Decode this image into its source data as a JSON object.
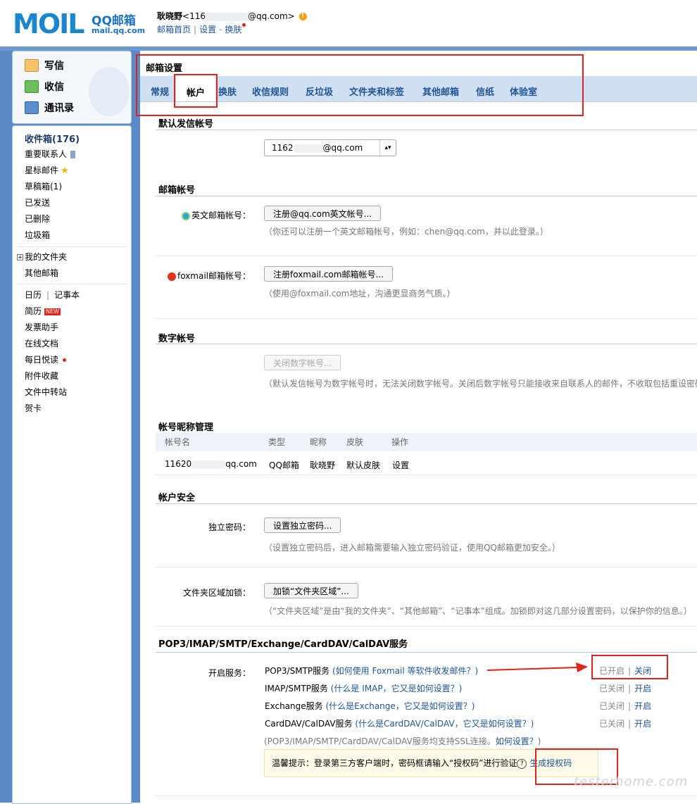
{
  "logo": {
    "big": "MOIL",
    "cn": "QQ邮箱",
    "domain": "mail.qq.com"
  },
  "user": {
    "name": "耿晓野",
    "email_prefix": "<116",
    "email_suffix": "@qq.com>",
    "links": {
      "home": "邮箱首页",
      "settings": "设置",
      "sep": "-",
      "skin": "换肤"
    }
  },
  "actions": [
    {
      "label": "写信",
      "icon": "pencil-icon"
    },
    {
      "label": "收信",
      "icon": "inbox-icon"
    },
    {
      "label": "通讯录",
      "icon": "contacts-icon"
    }
  ],
  "folders": {
    "inbox": "收件箱(176)",
    "vip": "重要联系人",
    "starred": "星标邮件",
    "drafts": "草稿箱(1)",
    "sent": "已发送",
    "deleted": "已删除",
    "spam": "垃圾箱",
    "my_folders": "我的文件夹",
    "other_mail": "其他邮箱",
    "calendar": "日历",
    "cal_sep": "|",
    "notes": "记事本",
    "resume": "简历",
    "new_badge": "NEW",
    "invoice": "发票助手",
    "docs": "在线文档",
    "daily": "每日悦读",
    "attach": "附件收藏",
    "transfer": "文件中转站",
    "card": "贺卡"
  },
  "settings": {
    "title": "邮箱设置",
    "tabs": [
      "常规",
      "帐户",
      "换肤",
      "收信规则",
      "反垃圾",
      "文件夹和标签",
      "其他邮箱",
      "信纸",
      "体验室"
    ],
    "active_tab": "帐户"
  },
  "default_sender": {
    "title": "默认发信帐号",
    "prefix": "1162",
    "suffix": "@qq.com"
  },
  "mail_accounts": {
    "title": "邮箱帐号",
    "english_label": "英文邮箱帐号：",
    "english_button": "注册@qq.com英文帐号...",
    "english_hint": "（你还可以注册一个英文邮箱帐号，例如：chen@qq.com，并以此登录。）",
    "foxmail_label": "foxmail邮箱帐号：",
    "foxmail_button": "注册foxmail.com邮箱帐号...",
    "foxmail_hint": "（使用@foxmail.com地址，沟通更显商务气质。）"
  },
  "digital": {
    "title": "数字帐号",
    "button": "关闭数字帐号...",
    "hint": "（默认发信帐号为数字帐号时，无法关闭数字帐号。关闭后数字帐号只能接收来自联系人的邮件，不收取包括重设密码"
  },
  "nicknames": {
    "title": "帐号昵称管理",
    "headers": [
      "帐号名",
      "类型",
      "昵称",
      "皮肤",
      "操作"
    ],
    "row": {
      "account_prefix": "11620",
      "account_suffix": "qq.com",
      "type": "QQ邮箱",
      "nickname": "耿晓野",
      "skin": "默认皮肤",
      "action": "设置"
    }
  },
  "security": {
    "title": "帐户安全",
    "pwd_label": "独立密码：",
    "pwd_button": "设置独立密码...",
    "pwd_hint": "（设置独立密码后，进入邮箱需要输入独立密码验证，使用QQ邮箱更加安全。）",
    "folder_label": "文件夹区域加锁：",
    "folder_button": "加锁“文件夹区域”...",
    "folder_hint": "（“文件夹区域”是由“我的文件夹”、“其他邮箱”、“记事本”组成。加锁即对这几部分设置密码，以保护你的信息。）"
  },
  "services": {
    "title": "POP3/IMAP/SMTP/Exchange/CardDAV/CalDAV服务",
    "label": "开启服务：",
    "rows": [
      {
        "name": "POP3/SMTP服务",
        "link": "(如何使用 Foxmail 等软件收发邮件？)",
        "state": "已开启",
        "action": "关闭"
      },
      {
        "name": "IMAP/SMTP服务",
        "link": "(什么是 IMAP，它又是如何设置？)",
        "state": "已关闭",
        "action": "开启"
      },
      {
        "name": "Exchange服务",
        "link": "(什么是Exchange，它又是如何设置？)",
        "state": "已关闭",
        "action": "开启"
      },
      {
        "name": "CardDAV/CalDAV服务",
        "link": "(什么是CardDAV/CalDAV，它又是如何设置？)",
        "state": "已关闭",
        "action": "开启"
      }
    ],
    "ssl_hint": "(POP3/IMAP/SMTP/CardDAV/CalDAV服务均支持SSL连接。",
    "ssl_link": "如何设置？",
    "ssl_close": ")",
    "state_sep": "|",
    "tip": "温馨提示：登录第三方客户端时，密码框请输入“授权码”进行验证",
    "tip_q": "?",
    "tip_link": "生成授权码"
  },
  "watermark": "testerhome.com",
  "colors": {
    "brand": "#1a86d0",
    "link": "#1e5494",
    "frame": "#5a8bc6",
    "tab_bar": "#cfe0f2",
    "annotation": "#e2231a"
  }
}
